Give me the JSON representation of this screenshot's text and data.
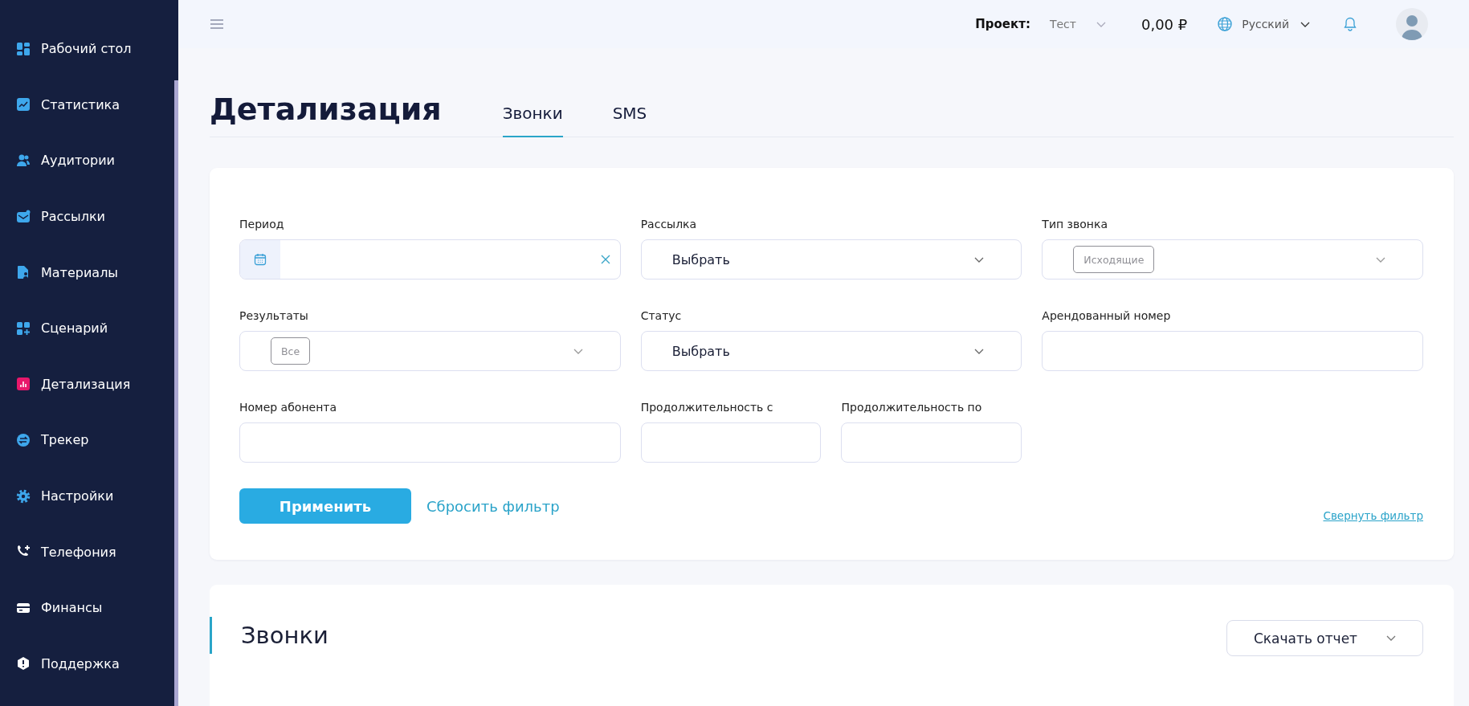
{
  "header": {
    "project_label": "Проект:",
    "project": "Тест",
    "balance": "0,00 ₽",
    "language": "Русский"
  },
  "sidebar": {
    "items": [
      {
        "label": "Рабочий стол",
        "selected": false
      },
      {
        "label": "Статистика",
        "selected": false
      },
      {
        "label": "Аудитории",
        "selected": false
      },
      {
        "label": "Рассылки",
        "selected": false
      },
      {
        "label": "Материалы",
        "selected": false
      },
      {
        "label": "Сценарий",
        "selected": false
      },
      {
        "label": "Детализация",
        "selected": true
      },
      {
        "label": "Трекер",
        "selected": false
      },
      {
        "label": "Настройки",
        "selected": false
      },
      {
        "label": "Телефония",
        "selected": false
      },
      {
        "label": "Финансы",
        "selected": false
      },
      {
        "label": "Поддержка",
        "selected": false
      }
    ]
  },
  "page": {
    "title": "Детализация",
    "tabs": [
      {
        "label": "Звонки",
        "selected": true
      },
      {
        "label": "SMS",
        "selected": false
      }
    ]
  },
  "filters": {
    "rows": [
      [
        {
          "label": "Период",
          "kind": "date"
        },
        {
          "label": "Рассылка",
          "kind": "select",
          "value": "Выбрать"
        },
        {
          "label": "Тип звонка",
          "kind": "tags",
          "tags": [
            "Исходящие"
          ]
        }
      ],
      [
        {
          "label": "Результаты",
          "kind": "tags",
          "tags": [
            "Все"
          ]
        },
        {
          "label": "Статус",
          "kind": "select",
          "value": "Выбрать"
        },
        {
          "label": "Арендованный номер",
          "kind": "text"
        }
      ],
      [
        {
          "label": "Номер абонента",
          "kind": "text"
        },
        {
          "label": "Продолжительность с",
          "kind": "text"
        },
        {
          "label": "Продолжительность по",
          "kind": "text"
        }
      ]
    ],
    "apply_button": "Применить",
    "reset_link": "Сбросить фильтр",
    "collapse_link": "Свернуть фильтр"
  },
  "calls": {
    "title": "Звонки",
    "download_button": "Скачать отчет"
  }
}
